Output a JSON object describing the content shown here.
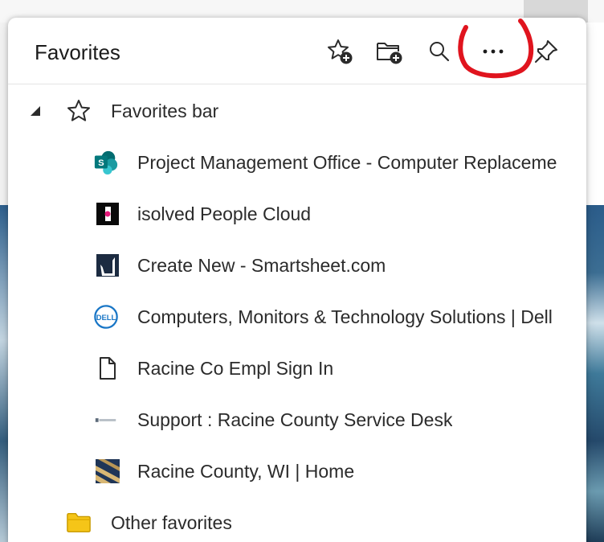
{
  "panel": {
    "title": "Favorites",
    "header_buttons": {
      "add_favorite": "add-favorite",
      "add_folder": "add-folder",
      "search": "search",
      "more_options": "more-options",
      "pin": "pin"
    }
  },
  "tree": {
    "favorites_bar": {
      "label": "Favorites bar",
      "expanded": true,
      "items": [
        {
          "label": "Project Management Office - Computer Replaceme",
          "icon": "sharepoint-icon"
        },
        {
          "label": "isolved People Cloud",
          "icon": "isolved-icon"
        },
        {
          "label": "Create New - Smartsheet.com",
          "icon": "smartsheet-icon"
        },
        {
          "label": "Computers, Monitors & Technology Solutions | Dell",
          "icon": "dell-icon"
        },
        {
          "label": "Racine Co Empl Sign In",
          "icon": "page-icon"
        },
        {
          "label": "Support : Racine County Service Desk",
          "icon": "service-desk-icon"
        },
        {
          "label": "Racine County, WI | Home",
          "icon": "racine-county-icon"
        }
      ]
    },
    "other_favorites": {
      "label": "Other favorites"
    }
  },
  "colors": {
    "annotation_red": "#e0141e",
    "folder_yellow": "#f5c518",
    "dell_blue": "#1976c6",
    "sharepoint_teal": "#038387"
  }
}
